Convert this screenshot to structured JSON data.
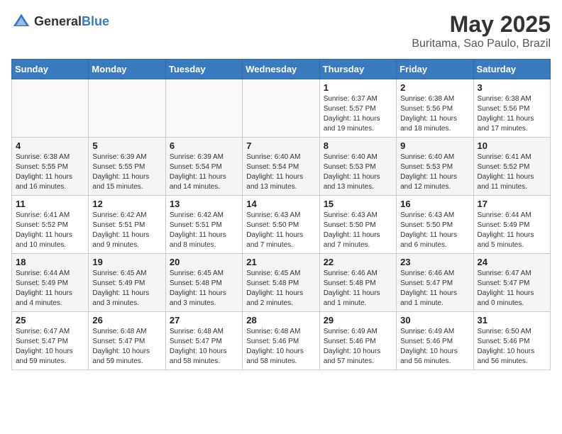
{
  "header": {
    "logo_general": "General",
    "logo_blue": "Blue",
    "month": "May 2025",
    "location": "Buritama, Sao Paulo, Brazil"
  },
  "weekdays": [
    "Sunday",
    "Monday",
    "Tuesday",
    "Wednesday",
    "Thursday",
    "Friday",
    "Saturday"
  ],
  "weeks": [
    [
      {
        "day": "",
        "detail": ""
      },
      {
        "day": "",
        "detail": ""
      },
      {
        "day": "",
        "detail": ""
      },
      {
        "day": "",
        "detail": ""
      },
      {
        "day": "1",
        "detail": "Sunrise: 6:37 AM\nSunset: 5:57 PM\nDaylight: 11 hours and 19 minutes."
      },
      {
        "day": "2",
        "detail": "Sunrise: 6:38 AM\nSunset: 5:56 PM\nDaylight: 11 hours and 18 minutes."
      },
      {
        "day": "3",
        "detail": "Sunrise: 6:38 AM\nSunset: 5:56 PM\nDaylight: 11 hours and 17 minutes."
      }
    ],
    [
      {
        "day": "4",
        "detail": "Sunrise: 6:38 AM\nSunset: 5:55 PM\nDaylight: 11 hours and 16 minutes."
      },
      {
        "day": "5",
        "detail": "Sunrise: 6:39 AM\nSunset: 5:55 PM\nDaylight: 11 hours and 15 minutes."
      },
      {
        "day": "6",
        "detail": "Sunrise: 6:39 AM\nSunset: 5:54 PM\nDaylight: 11 hours and 14 minutes."
      },
      {
        "day": "7",
        "detail": "Sunrise: 6:40 AM\nSunset: 5:54 PM\nDaylight: 11 hours and 13 minutes."
      },
      {
        "day": "8",
        "detail": "Sunrise: 6:40 AM\nSunset: 5:53 PM\nDaylight: 11 hours and 13 minutes."
      },
      {
        "day": "9",
        "detail": "Sunrise: 6:40 AM\nSunset: 5:53 PM\nDaylight: 11 hours and 12 minutes."
      },
      {
        "day": "10",
        "detail": "Sunrise: 6:41 AM\nSunset: 5:52 PM\nDaylight: 11 hours and 11 minutes."
      }
    ],
    [
      {
        "day": "11",
        "detail": "Sunrise: 6:41 AM\nSunset: 5:52 PM\nDaylight: 11 hours and 10 minutes."
      },
      {
        "day": "12",
        "detail": "Sunrise: 6:42 AM\nSunset: 5:51 PM\nDaylight: 11 hours and 9 minutes."
      },
      {
        "day": "13",
        "detail": "Sunrise: 6:42 AM\nSunset: 5:51 PM\nDaylight: 11 hours and 8 minutes."
      },
      {
        "day": "14",
        "detail": "Sunrise: 6:43 AM\nSunset: 5:50 PM\nDaylight: 11 hours and 7 minutes."
      },
      {
        "day": "15",
        "detail": "Sunrise: 6:43 AM\nSunset: 5:50 PM\nDaylight: 11 hours and 7 minutes."
      },
      {
        "day": "16",
        "detail": "Sunrise: 6:43 AM\nSunset: 5:50 PM\nDaylight: 11 hours and 6 minutes."
      },
      {
        "day": "17",
        "detail": "Sunrise: 6:44 AM\nSunset: 5:49 PM\nDaylight: 11 hours and 5 minutes."
      }
    ],
    [
      {
        "day": "18",
        "detail": "Sunrise: 6:44 AM\nSunset: 5:49 PM\nDaylight: 11 hours and 4 minutes."
      },
      {
        "day": "19",
        "detail": "Sunrise: 6:45 AM\nSunset: 5:49 PM\nDaylight: 11 hours and 3 minutes."
      },
      {
        "day": "20",
        "detail": "Sunrise: 6:45 AM\nSunset: 5:48 PM\nDaylight: 11 hours and 3 minutes."
      },
      {
        "day": "21",
        "detail": "Sunrise: 6:45 AM\nSunset: 5:48 PM\nDaylight: 11 hours and 2 minutes."
      },
      {
        "day": "22",
        "detail": "Sunrise: 6:46 AM\nSunset: 5:48 PM\nDaylight: 11 hours and 1 minute."
      },
      {
        "day": "23",
        "detail": "Sunrise: 6:46 AM\nSunset: 5:47 PM\nDaylight: 11 hours and 1 minute."
      },
      {
        "day": "24",
        "detail": "Sunrise: 6:47 AM\nSunset: 5:47 PM\nDaylight: 11 hours and 0 minutes."
      }
    ],
    [
      {
        "day": "25",
        "detail": "Sunrise: 6:47 AM\nSunset: 5:47 PM\nDaylight: 10 hours and 59 minutes."
      },
      {
        "day": "26",
        "detail": "Sunrise: 6:48 AM\nSunset: 5:47 PM\nDaylight: 10 hours and 59 minutes."
      },
      {
        "day": "27",
        "detail": "Sunrise: 6:48 AM\nSunset: 5:47 PM\nDaylight: 10 hours and 58 minutes."
      },
      {
        "day": "28",
        "detail": "Sunrise: 6:48 AM\nSunset: 5:46 PM\nDaylight: 10 hours and 58 minutes."
      },
      {
        "day": "29",
        "detail": "Sunrise: 6:49 AM\nSunset: 5:46 PM\nDaylight: 10 hours and 57 minutes."
      },
      {
        "day": "30",
        "detail": "Sunrise: 6:49 AM\nSunset: 5:46 PM\nDaylight: 10 hours and 56 minutes."
      },
      {
        "day": "31",
        "detail": "Sunrise: 6:50 AM\nSunset: 5:46 PM\nDaylight: 10 hours and 56 minutes."
      }
    ]
  ]
}
